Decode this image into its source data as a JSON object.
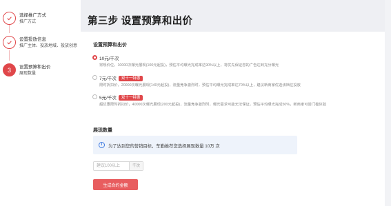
{
  "steps": [
    {
      "index": "",
      "title": "选择推广方式",
      "subtitle": "推广方式",
      "state": "done"
    },
    {
      "index": "",
      "title": "设置投放信息",
      "subtitle": "推广主体、投放地域、投放创意",
      "state": "done"
    },
    {
      "index": "3",
      "title": "设置预算和出价",
      "subtitle": "展现数量",
      "state": "active"
    }
  ],
  "header": {
    "title": "第三步 设置预算和出价"
  },
  "budget_section": {
    "title": "设置预算和出价",
    "options": [
      {
        "label": "10元/千次",
        "tag": "",
        "checked": true,
        "desc": "常规价位，10000次曝光展现(100元起投)，预估平均曝光完成率达90%以上，将优先保证您的广告达到充分曝光"
      },
      {
        "label": "7元/千次",
        "tag": "双十一特惠",
        "checked": false,
        "desc": "限时折扣价，20000次曝光展现(140元起投)，流量竞争激烈时，预估平均曝光完成率达70%以上，建议新商家优选该档位投放"
      },
      {
        "label": "5元/千次",
        "tag": "双十一特惠",
        "checked": false,
        "desc": "超优惠限时折扣价，40000次曝光展现(200元起投)，流量竞争激烈时，曝光需求可能无法保证，预估平均曝光完成50%，新商家可尝门槛体验"
      }
    ]
  },
  "exposure_section": {
    "title": "展现数量",
    "info_icon": "info-icon",
    "info_text": "为了达到您的营销目标，车勤推荐您选择展现数量 10万 次",
    "input_placeholder": "建议100以上",
    "input_value": "",
    "input_suffix": "千次",
    "generate_button": "生成合约金额"
  },
  "colors": {
    "accent": "#e0474a",
    "info_bg": "#eef3fb",
    "info_blue": "#3d7ae0"
  }
}
